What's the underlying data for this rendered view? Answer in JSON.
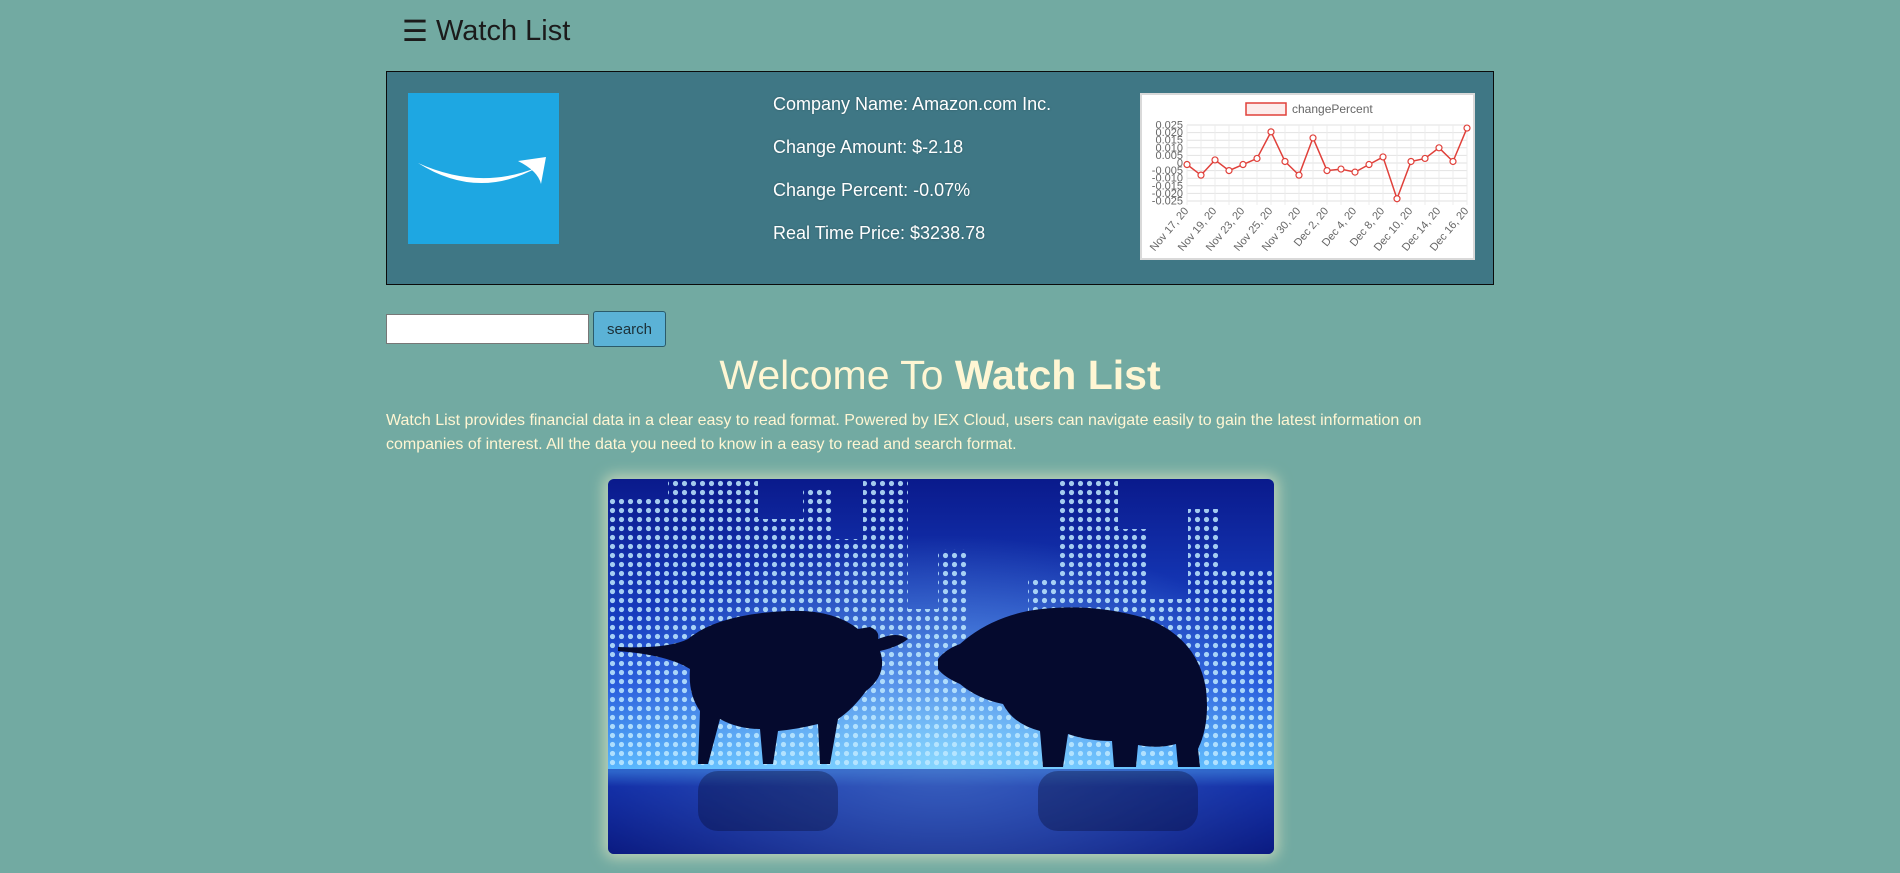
{
  "header": {
    "menu_icon": "☰",
    "title": "Watch List"
  },
  "stock": {
    "logo_icon": "amazon-smile-logo",
    "company_name": "Company Name: Amazon.com Inc.",
    "change_amount": "Change Amount: $-2.18",
    "change_percent": "Change Percent: -0.07%",
    "real_time_price": "Real Time Price: $3238.78"
  },
  "chart_data": {
    "type": "line",
    "legend": [
      "changePercent"
    ],
    "legend_position": "top",
    "grid": true,
    "ylim": [
      -0.025,
      0.025
    ],
    "yticks": [
      "0.025",
      "0.020",
      "0.015",
      "0.010",
      "0.005",
      "0",
      "-0.005",
      "-0.010",
      "-0.015",
      "-0.020",
      "-0.025"
    ],
    "xticks": [
      "Nov 17, 20",
      "Nov 19, 20",
      "Nov 23, 20",
      "Nov 25, 20",
      "Nov 30, 20",
      "Dec 2, 20",
      "Dec 4, 20",
      "Dec 8, 20",
      "Dec 10, 20",
      "Dec 14, 20",
      "Dec 16, 20"
    ],
    "series": [
      {
        "name": "changePercent",
        "color": "#e0403a",
        "values": [
          -0.001,
          -0.008,
          0.002,
          -0.005,
          -0.001,
          0.003,
          0.0205,
          0.001,
          -0.008,
          0.0165,
          -0.005,
          -0.004,
          -0.006,
          -0.001,
          0.004,
          -0.0235,
          0.001,
          0.003,
          0.01,
          0.001,
          0.023
        ]
      }
    ]
  },
  "search": {
    "placeholder": "",
    "button_label": "search"
  },
  "welcome": {
    "prefix": "Welcome To ",
    "bold": "Watch List"
  },
  "description": "Watch List provides financial data in a clear easy to read format. Powered by IEX Cloud, users can navigate easily to gain the latest information on companies of interest. All the data you need to know in a easy to read and search format.",
  "hero_image": {
    "icon": "bull-and-bear-image"
  },
  "colors": {
    "background": "#72aaa2",
    "card": "#3f7785",
    "logo_bg": "#1ea7e2",
    "accent_button": "#5bb2d6",
    "text_cream": "#fff6d3"
  }
}
